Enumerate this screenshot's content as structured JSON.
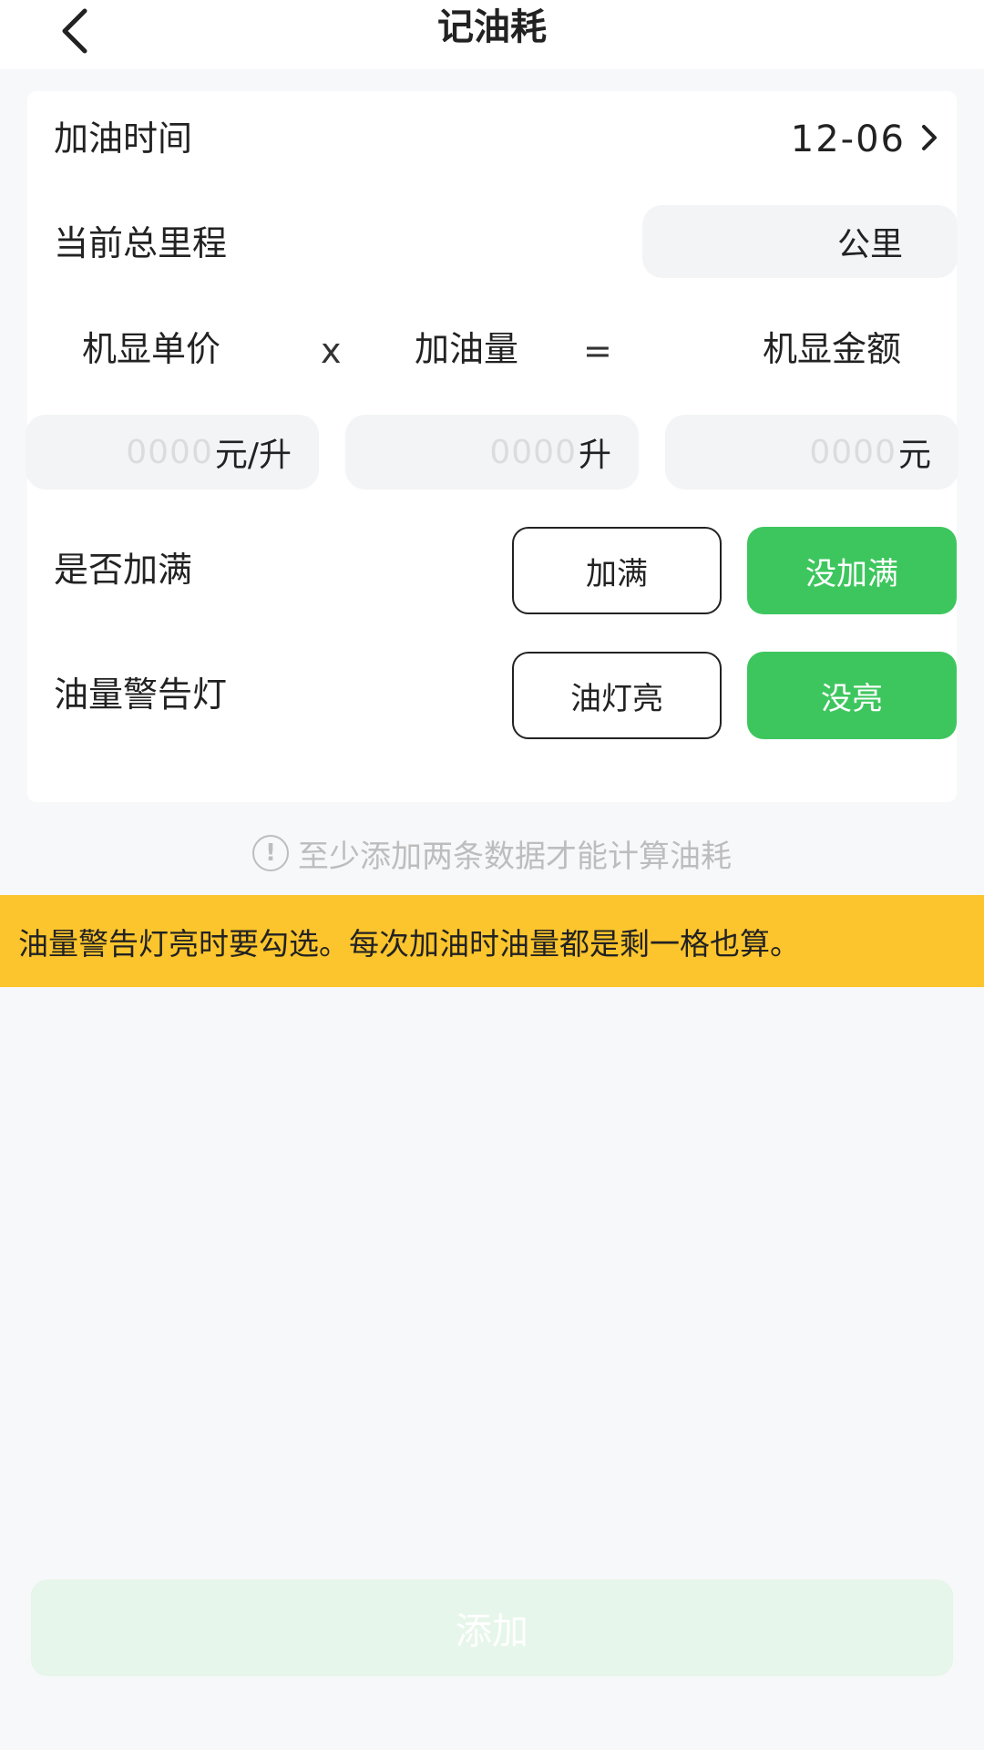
{
  "header": {
    "title": "记油耗"
  },
  "form": {
    "refuel_time": {
      "label": "加油时间",
      "value": "12-06"
    },
    "mileage": {
      "label": "当前总里程",
      "value": "",
      "unit": "公里"
    },
    "calc_headers": {
      "unit_price": "机显单价",
      "multiply": "x",
      "volume": "加油量",
      "equals": "=",
      "amount": "机显金额"
    },
    "unit_price": {
      "placeholder": "0000",
      "unit": "元/升"
    },
    "volume": {
      "placeholder": "0000",
      "unit": "升"
    },
    "amount": {
      "placeholder": "0000",
      "unit": "元"
    },
    "full_tank": {
      "label": "是否加满",
      "options": [
        "加满",
        "没加满"
      ],
      "selected": "没加满"
    },
    "warning_light": {
      "label": "油量警告灯",
      "options": [
        "油灯亮",
        "没亮"
      ],
      "selected": "没亮"
    }
  },
  "hint": {
    "icon": "info-icon",
    "text": "至少添加两条数据才能计算油耗"
  },
  "banner": {
    "text": "油量警告灯亮时要勾选。每次加油时油量都是剩一格也算。"
  },
  "footer": {
    "add_label": "添加"
  },
  "colors": {
    "accent_green": "#3ec65e",
    "banner_yellow": "#fcc52d",
    "disabled_green": "#e6f6ea"
  }
}
